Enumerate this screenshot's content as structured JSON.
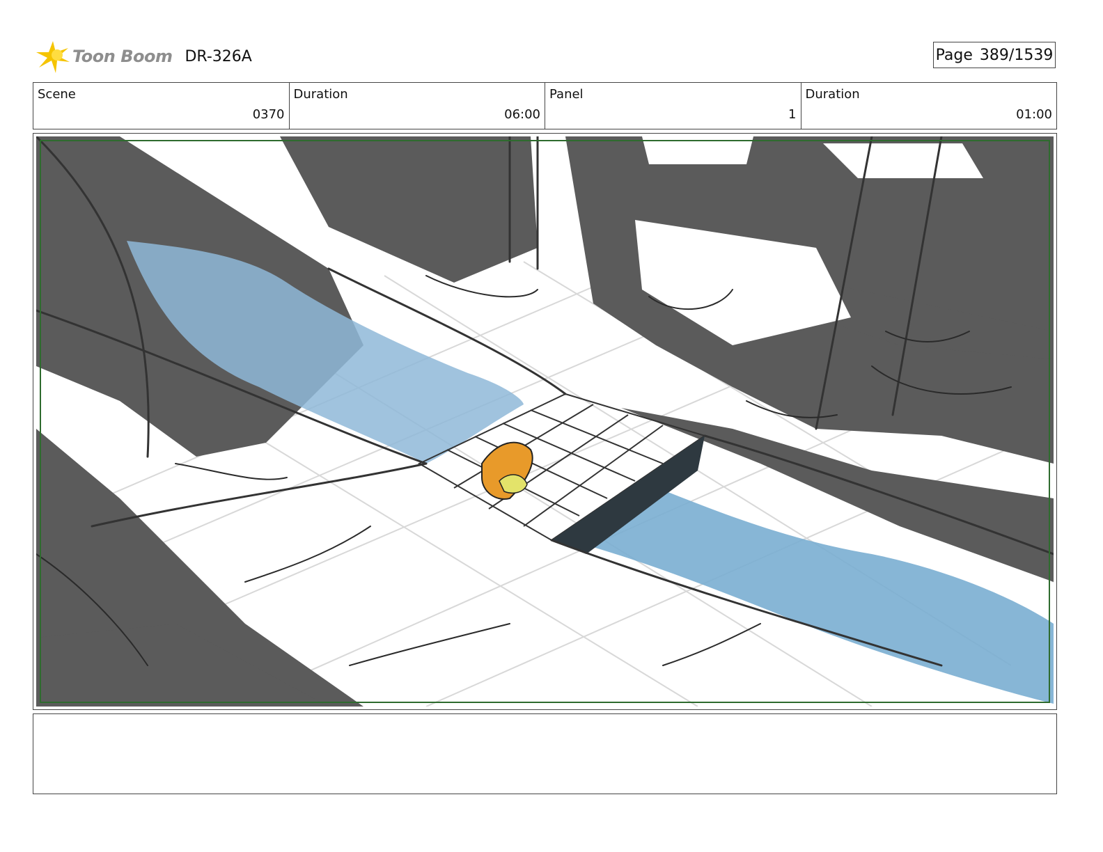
{
  "header": {
    "brand": "Toon Boom",
    "doc_id": "DR-326A",
    "page_label": "Page",
    "page_value": "389/1539"
  },
  "info": {
    "scene_label": "Scene",
    "scene_value": "0370",
    "duration1_label": "Duration",
    "duration1_value": "06:00",
    "panel_label": "Panel",
    "panel_value": "1",
    "duration2_label": "Duration",
    "duration2_value": "01:00"
  },
  "colors": {
    "brand_yellow": "#f5c400",
    "safe_frame_green": "#2e6b2e",
    "shadow_gray": "#5b5b5b",
    "water_blue": "#7fb1d4",
    "character_orange": "#e89a2a"
  },
  "notes": {
    "text": ""
  }
}
